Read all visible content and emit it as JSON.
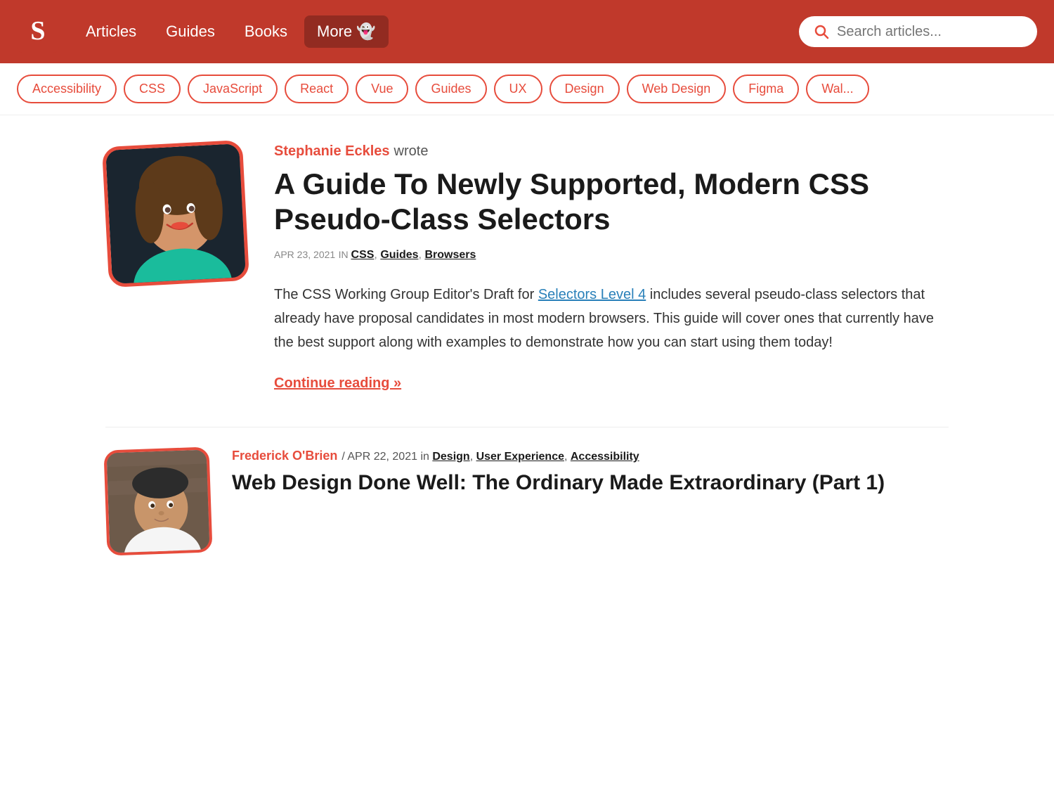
{
  "navbar": {
    "logo_alt": "Smashing Magazine",
    "links": [
      {
        "label": "Articles",
        "href": "#"
      },
      {
        "label": "Guides",
        "href": "#"
      },
      {
        "label": "Books",
        "href": "#"
      },
      {
        "label": "More",
        "href": "#",
        "special": true
      }
    ],
    "search_placeholder": "Search articles..."
  },
  "tags": [
    {
      "label": "Accessibility"
    },
    {
      "label": "CSS"
    },
    {
      "label": "JavaScript"
    },
    {
      "label": "React"
    },
    {
      "label": "Vue"
    },
    {
      "label": "Guides"
    },
    {
      "label": "UX"
    },
    {
      "label": "Design"
    },
    {
      "label": "Web Design"
    },
    {
      "label": "Figma"
    },
    {
      "label": "Wal..."
    }
  ],
  "articles": [
    {
      "author_name": "Stephanie Eckles",
      "author_wrote": "wrote",
      "title": "A Guide To Newly Supported, Modern CSS Pseudo-Class Selectors",
      "date": "APR 23, 2021",
      "in_label": "in",
      "categories": [
        "CSS",
        "Guides",
        "Browsers"
      ],
      "excerpt_before_link": "The CSS Working Group Editor's Draft for ",
      "excerpt_link_text": "Selectors Level 4",
      "excerpt_after_link": " includes several pseudo-class selectors that already have proposal candidates in most modern browsers. This guide will cover ones that currently have the best support along with examples to demonstrate how you can start using them today!",
      "continue_reading": "Continue reading »"
    },
    {
      "author_name": "Frederick O'Brien",
      "date": "APR 22, 2021",
      "in_label": "in",
      "categories": [
        "Design",
        "User Experience",
        "Accessibility"
      ],
      "title": "Web Design Done Well: The Ordinary Made Extraordinary (Part 1)"
    }
  ]
}
